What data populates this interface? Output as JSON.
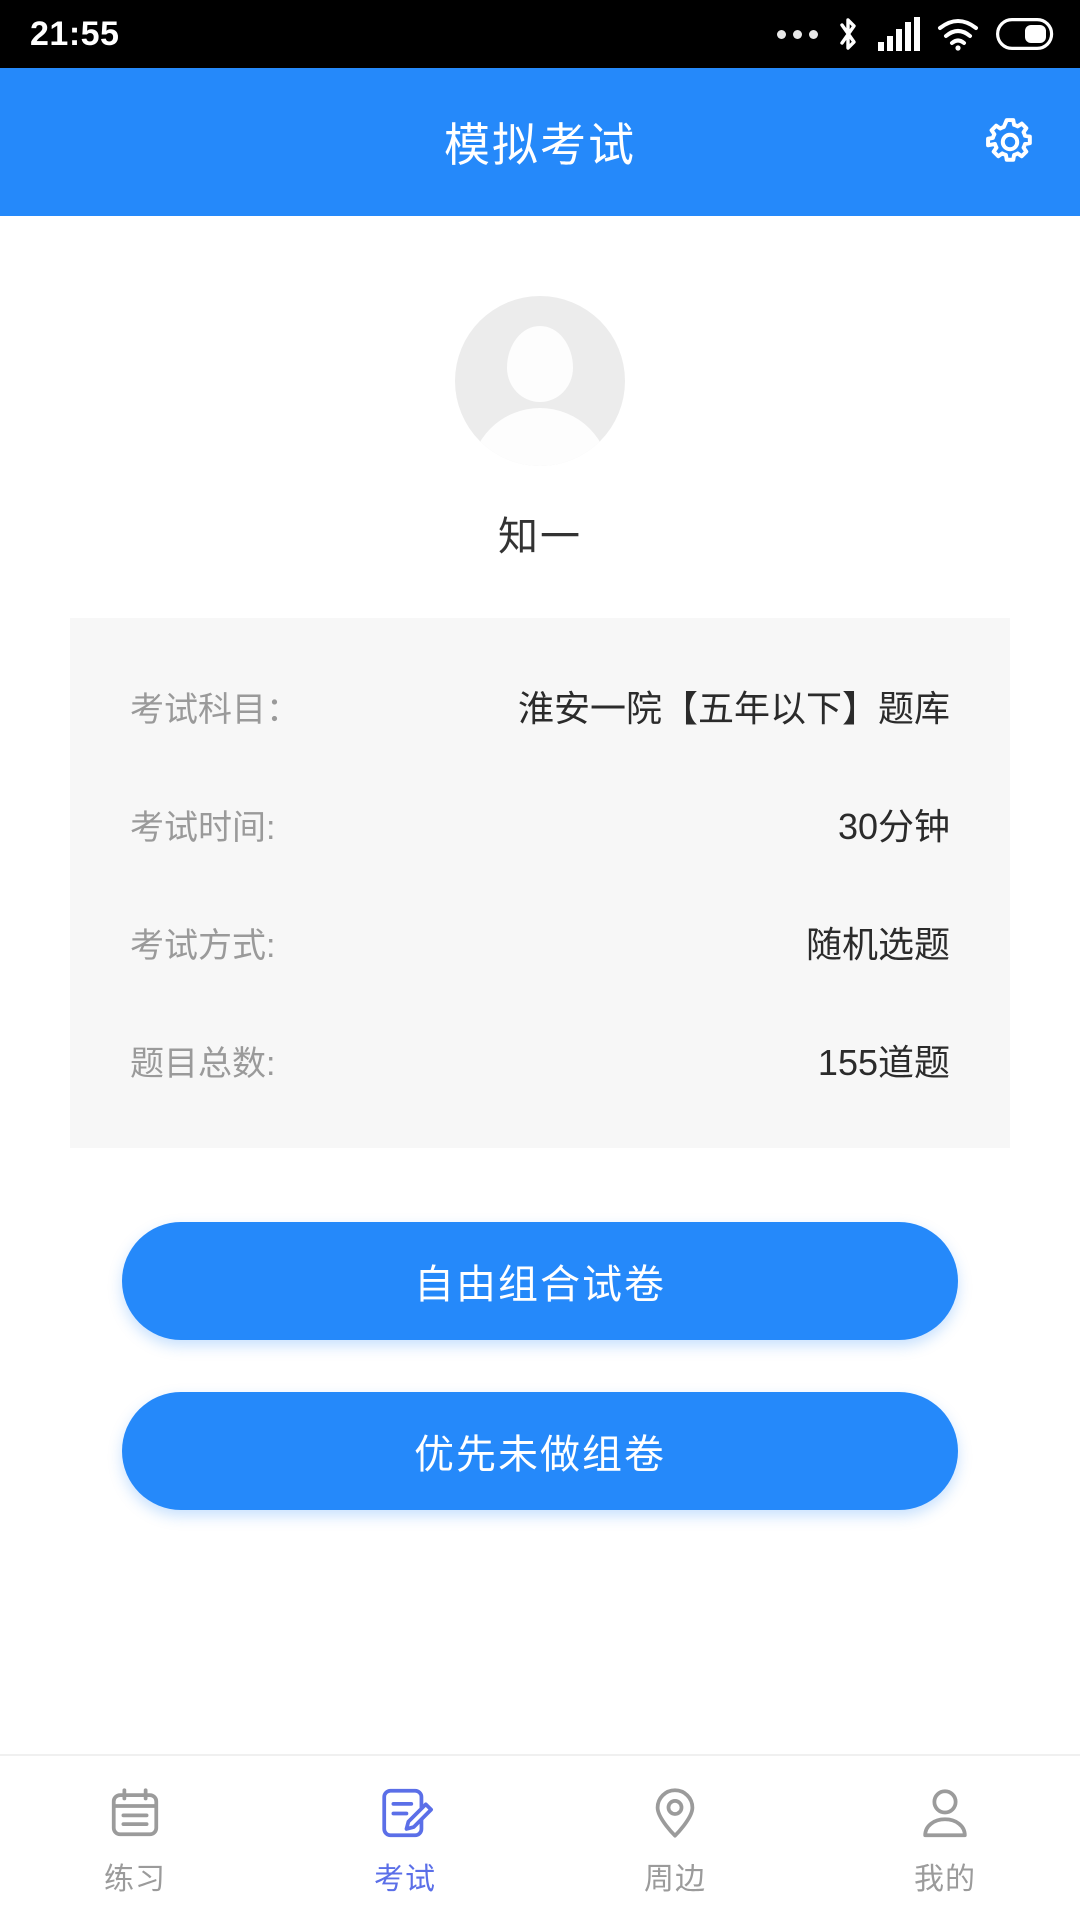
{
  "statusbar": {
    "time": "21:55",
    "icons": [
      "more-dots-icon",
      "bluetooth-icon",
      "cellular-signal-icon",
      "wifi-icon",
      "battery-icon"
    ]
  },
  "header": {
    "title": "模拟考试",
    "settings_icon": "gear-icon",
    "background_color": "#2589FA"
  },
  "profile": {
    "avatar_icon": "default-user-avatar-icon",
    "username": "知一"
  },
  "info_card": {
    "background_color": "#F7F7F7",
    "rows": [
      {
        "label": "考试科目：",
        "value": "淮安一院【五年以下】题库"
      },
      {
        "label": "考试时间:",
        "value": "30分钟"
      },
      {
        "label": "考试方式:",
        "value": "随机选题"
      },
      {
        "label": "题目总数:",
        "value": "155道题"
      }
    ]
  },
  "actions": {
    "primary_color": "#2589FA",
    "free_combine_label": "自由组合试卷",
    "unanswered_first_label": "优先未做组卷"
  },
  "tabbar": {
    "active_color": "#5B6FE8",
    "inactive_color": "#9B9B9B",
    "tabs": [
      {
        "label": "练习",
        "icon": "calendar-list-icon",
        "active": false
      },
      {
        "label": "考试",
        "icon": "document-pencil-icon",
        "active": true
      },
      {
        "label": "周边",
        "icon": "location-pin-icon",
        "active": false
      },
      {
        "label": "我的",
        "icon": "person-icon",
        "active": false
      }
    ]
  }
}
